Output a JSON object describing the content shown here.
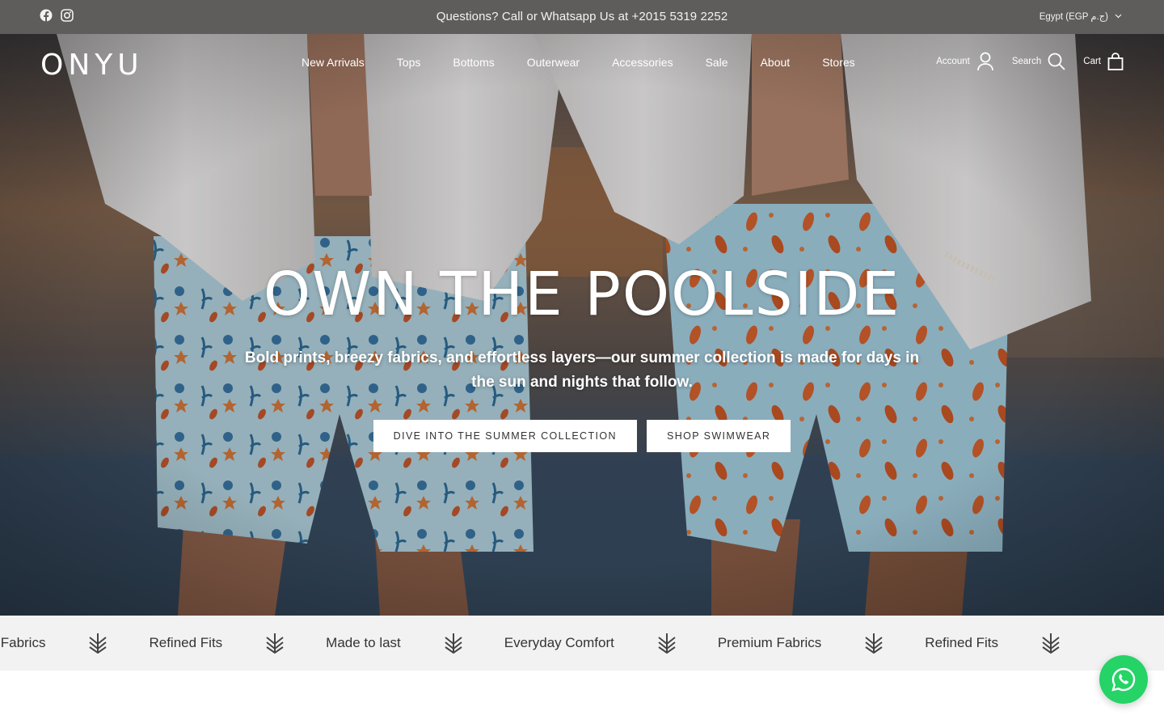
{
  "topbar": {
    "announcement": "Questions? Call or Whatsapp Us at +2015 5319 2252",
    "country": "Egypt (EGP ج.م)",
    "social_icons": [
      "facebook-icon",
      "instagram-icon"
    ]
  },
  "header": {
    "logo": "ONYU",
    "nav": [
      "New Arrivals",
      "Tops",
      "Bottoms",
      "Outerwear",
      "Accessories",
      "Sale",
      "About",
      "Stores"
    ],
    "account_label": "Account",
    "search_label": "Search",
    "cart_label": "Cart"
  },
  "hero": {
    "title": "OWN THE POOLSIDE",
    "subtitle": "Bold prints, breezy fabrics, and effortless layers—our summer collection is made for days in the sun and nights that follow.",
    "buttons": [
      "DIVE INTO THE SUMMER COLLECTION",
      "SHOP SWIMWEAR"
    ]
  },
  "marquee": {
    "items": [
      "Premium Fabrics",
      "Refined Fits",
      "Made to last",
      "Everyday Comfort",
      "Premium Fabrics",
      "Refined Fits"
    ]
  },
  "colors": {
    "topbar_bg": "#5f5d5b",
    "marquee_bg": "#f2f2f2",
    "whatsapp": "#25d366"
  }
}
